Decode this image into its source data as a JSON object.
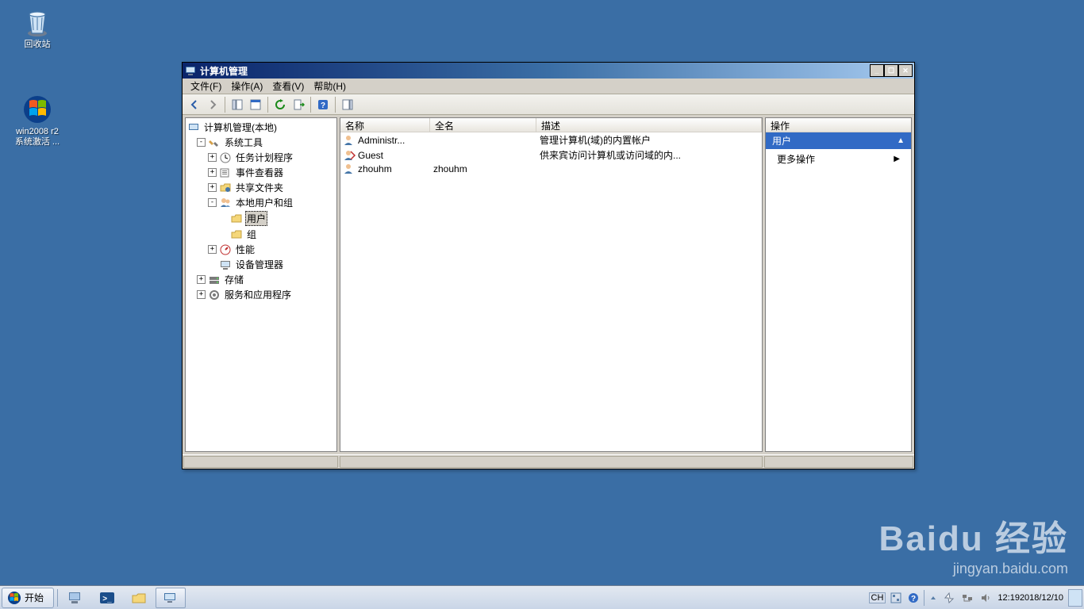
{
  "desktop": {
    "recycle": {
      "label": "回收站"
    },
    "win2008": {
      "label1": "win2008 r2",
      "label2": "系统激活 ..."
    }
  },
  "window": {
    "title": "计算机管理",
    "menu": {
      "file": "文件(F)",
      "action": "操作(A)",
      "view": "查看(V)",
      "help": "帮助(H)"
    },
    "tree": {
      "root": "计算机管理(本地)",
      "system_tools": "系统工具",
      "task_scheduler": "任务计划程序",
      "event_viewer": "事件查看器",
      "shared_folders": "共享文件夹",
      "local_users_groups": "本地用户和组",
      "users": "用户",
      "groups": "组",
      "performance": "性能",
      "device_manager": "设备管理器",
      "storage": "存储",
      "services_apps": "服务和应用程序"
    },
    "list": {
      "columns": [
        "名称",
        "全名",
        "描述"
      ],
      "rows": [
        {
          "name": "Administr...",
          "fullname": "",
          "desc": "管理计算机(域)的内置帐户"
        },
        {
          "name": "Guest",
          "fullname": "",
          "desc": "供来宾访问计算机或访问域的内..."
        },
        {
          "name": "zhouhm",
          "fullname": "zhouhm",
          "desc": ""
        }
      ]
    },
    "actions": {
      "header": "操作",
      "section": "用户",
      "more": "更多操作"
    }
  },
  "taskbar": {
    "start": "开始",
    "lang": "CH",
    "time": "12:19",
    "date": "2018/12/10"
  },
  "watermark": {
    "brand": "Baidu 经验",
    "url": "jingyan.baidu.com"
  }
}
